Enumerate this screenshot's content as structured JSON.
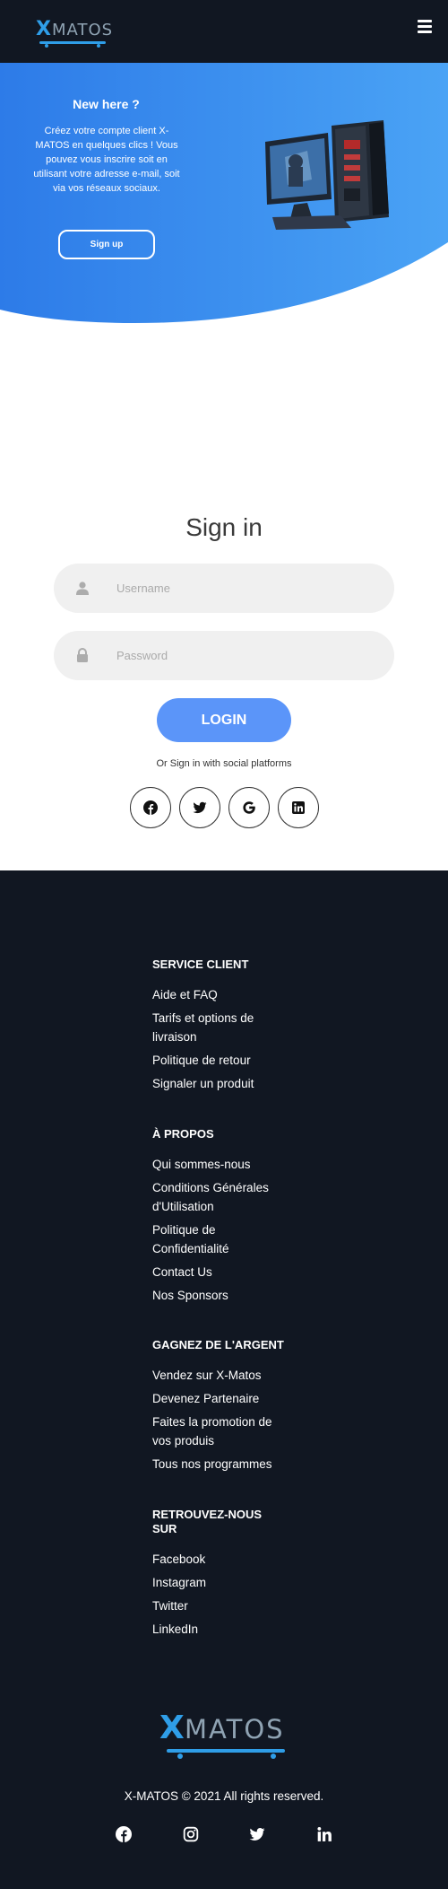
{
  "header": {
    "logo_x": "X",
    "logo_rest": "MATOS",
    "menu_icon": "hamburger-icon"
  },
  "hero": {
    "title": "New here ?",
    "text": "Créez votre compte client X-MATOS en quelques clics ! Vous pouvez vous inscrire soit en utilisant votre adresse e-mail, soit via vos réseaux sociaux.",
    "signup_label": "Sign up",
    "illustration": "gaming-pc-illustration",
    "gradient": [
      "#2d7be8",
      "#4aa3f5"
    ]
  },
  "signin": {
    "title": "Sign in",
    "username_placeholder": "Username",
    "password_placeholder": "Password",
    "login_label": "LOGIN",
    "social_text": "Or Sign in with social platforms",
    "social_icons": [
      "facebook-icon",
      "twitter-icon",
      "google-icon",
      "linkedin-icon"
    ],
    "accent": "#5b95f9"
  },
  "footer": {
    "background": "#111722",
    "sections": [
      {
        "title": "SERVICE CLIENT",
        "links": [
          "Aide et FAQ",
          "Tarifs et options de livraison",
          "Politique de retour",
          "Signaler un produit"
        ]
      },
      {
        "title": "À PROPOS",
        "links": [
          "Qui sommes-nous",
          "Conditions Générales d'Utilisation",
          "Politique de Confidentialité",
          "Contact Us",
          "Nos Sponsors"
        ]
      },
      {
        "title": "GAGNEZ DE L'ARGENT",
        "links": [
          "Vendez sur X-Matos",
          "Devenez Partenaire",
          "Faites la promotion de vos produis",
          "Tous nos programmes"
        ]
      },
      {
        "title": "RETROUVEZ-NOUS SUR",
        "links": [
          "Facebook",
          "Instagram",
          "Twitter",
          "LinkedIn"
        ]
      }
    ],
    "logo_x": "X",
    "logo_rest": "MATOS",
    "copyright": "X-MATOS © 2021 All rights reserved.",
    "social_icons": [
      "facebook-icon",
      "instagram-icon",
      "twitter-icon",
      "linkedin-icon"
    ]
  }
}
